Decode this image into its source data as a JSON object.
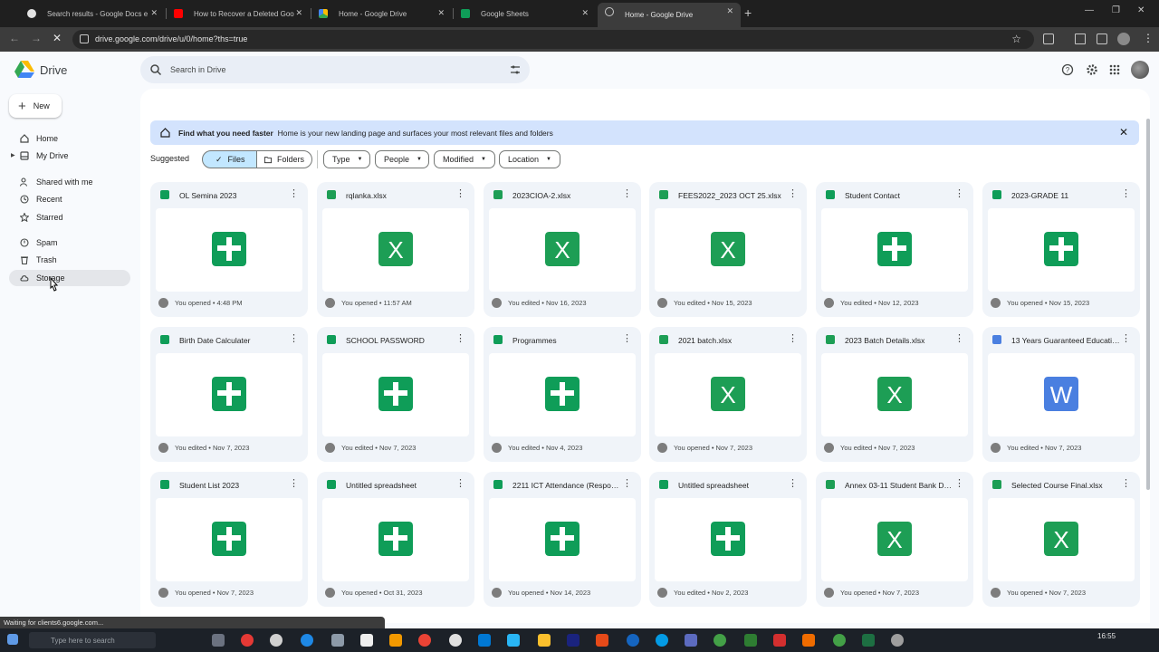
{
  "browser": {
    "tabs": [
      {
        "title": "Search results - Google Docs e",
        "icon": "google-icon",
        "active": false
      },
      {
        "title": "How to Recover a Deleted Goo",
        "icon": "youtube-icon",
        "active": false
      },
      {
        "title": "Home - Google Drive",
        "icon": "drive-icon",
        "active": false
      },
      {
        "title": "Google Sheets",
        "icon": "sheets-icon",
        "active": false
      },
      {
        "title": "Home - Google Drive",
        "icon": "globe-icon",
        "active": true
      }
    ],
    "url": "drive.google.com/drive/u/0/home?ths=true",
    "status_text": "Waiting for clients6.google.com..."
  },
  "app": {
    "name": "Drive",
    "search_placeholder": "Search in Drive"
  },
  "sidebar": {
    "new_label": "New",
    "items": [
      {
        "label": "Home",
        "icon": "home-icon"
      },
      {
        "label": "My Drive",
        "icon": "my-drive-icon"
      },
      {
        "label": "Shared with me",
        "icon": "people-icon"
      },
      {
        "label": "Recent",
        "icon": "clock-icon"
      },
      {
        "label": "Starred",
        "icon": "star-icon"
      },
      {
        "label": "Spam",
        "icon": "spam-icon"
      },
      {
        "label": "Trash",
        "icon": "trash-icon"
      },
      {
        "label": "Storage",
        "icon": "cloud-icon"
      }
    ]
  },
  "banner": {
    "bold": "Find what you need faster",
    "text": "Home is your new landing page and surfaces your most relevant files and folders"
  },
  "filters": {
    "suggested_label": "Suggested",
    "files_label": "Files",
    "folders_label": "Folders",
    "chips": [
      "Type",
      "People",
      "Modified",
      "Location"
    ]
  },
  "files": [
    {
      "name": "OL Semina 2023",
      "type": "sheets",
      "meta": "You opened • 4:48 PM"
    },
    {
      "name": "rqlanka.xlsx",
      "type": "excel",
      "meta": "You opened • 11:57 AM"
    },
    {
      "name": "2023CIOA-2.xlsx",
      "type": "excel",
      "meta": "You edited • Nov 16, 2023"
    },
    {
      "name": "FEES2022_2023 OCT 25.xlsx",
      "type": "excel",
      "meta": "You edited • Nov 15, 2023"
    },
    {
      "name": "Student Contact",
      "type": "sheets",
      "meta": "You edited • Nov 12, 2023"
    },
    {
      "name": "2023-GRADE 11",
      "type": "sheets",
      "meta": "You opened • Nov 15, 2023"
    },
    {
      "name": "Birth Date Calculater",
      "type": "sheets",
      "meta": "You edited • Nov 7, 2023"
    },
    {
      "name": "SCHOOL PASSWORD",
      "type": "sheets",
      "meta": "You edited • Nov 7, 2023"
    },
    {
      "name": "Programmes",
      "type": "sheets",
      "meta": "You edited • Nov 4, 2023"
    },
    {
      "name": "2021 batch.xlsx",
      "type": "excel",
      "meta": "You opened • Nov 7, 2023"
    },
    {
      "name": "2023 Batch Details.xlsx",
      "type": "excel",
      "meta": "You edited • Nov 7, 2023"
    },
    {
      "name": "13 Years Guaranteed Educatio...",
      "type": "word",
      "meta": "You edited • Nov 7, 2023"
    },
    {
      "name": "Student List 2023",
      "type": "sheets",
      "meta": "You opened • Nov 7, 2023"
    },
    {
      "name": "Untitled spreadsheet",
      "type": "sheets",
      "meta": "You opened • Oct 31, 2023"
    },
    {
      "name": "2211 ICT Attendance (Respons...",
      "type": "sheets",
      "meta": "You opened • Nov 14, 2023"
    },
    {
      "name": "Untitled spreadsheet",
      "type": "sheets",
      "meta": "You edited • Nov 2, 2023"
    },
    {
      "name": "Annex 03-11 Student Bank Det...",
      "type": "excel",
      "meta": "You opened • Nov 7, 2023"
    },
    {
      "name": "Selected Course Final.xlsx",
      "type": "excel",
      "meta": "You opened • Nov 7, 2023"
    }
  ],
  "taskbar": {
    "search_placeholder": "Type here to search",
    "time": "16:55"
  },
  "colors": {
    "sheets": "#0f9d58",
    "excel": "#1d9e55",
    "word": "#4a7fe0",
    "banner": "#d3e3fd",
    "selected_segment": "#c2e7ff"
  }
}
